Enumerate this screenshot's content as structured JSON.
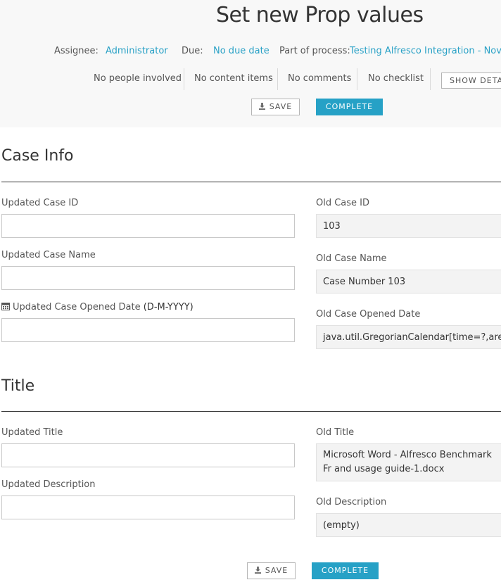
{
  "header": {
    "title": "Set new Prop values",
    "assignee_label": "Assignee:",
    "assignee_value": "Administrator",
    "due_label": "Due:",
    "due_value": "No due date",
    "process_label": "Part of process:",
    "process_value": "Testing Alfresco Integration - Nove",
    "stats": {
      "people": "No people involved",
      "content": "No content items",
      "comments": "No comments",
      "checklist": "No checklist"
    },
    "show_details_label": "SHOW DETA",
    "save_label": "SAVE",
    "complete_label": "COMPLETE"
  },
  "case_info": {
    "heading": "Case Info",
    "updated_case_id_label": "Updated Case ID",
    "updated_case_id_value": "",
    "updated_case_name_label": "Updated Case Name",
    "updated_case_name_value": "",
    "updated_opened_date_label": "Updated Case Opened Date",
    "updated_opened_date_format": "(D-M-YYYY)",
    "updated_opened_date_value": "",
    "old_case_id_label": "Old Case ID",
    "old_case_id_value": "103",
    "old_case_name_label": "Old Case Name",
    "old_case_name_value": "Case Number 103",
    "old_opened_date_label": "Old Case Opened Date",
    "old_opened_date_value": "java.util.GregorianCalendar[time=?,areFie"
  },
  "title_section": {
    "heading": "Title",
    "updated_title_label": "Updated Title",
    "updated_title_value": "",
    "updated_description_label": "Updated Description",
    "updated_description_value": "",
    "old_title_label": "Old Title",
    "old_title_value": "Microsoft Word - Alfresco Benchmark Fr and usage guide-1.docx",
    "old_description_label": "Old Description",
    "old_description_value": "(empty)"
  },
  "footer": {
    "save_label": "SAVE",
    "complete_label": "COMPLETE"
  },
  "colors": {
    "accent": "#26a1c6",
    "link": "#29a1c6",
    "header_bg": "#f8f8f8"
  }
}
